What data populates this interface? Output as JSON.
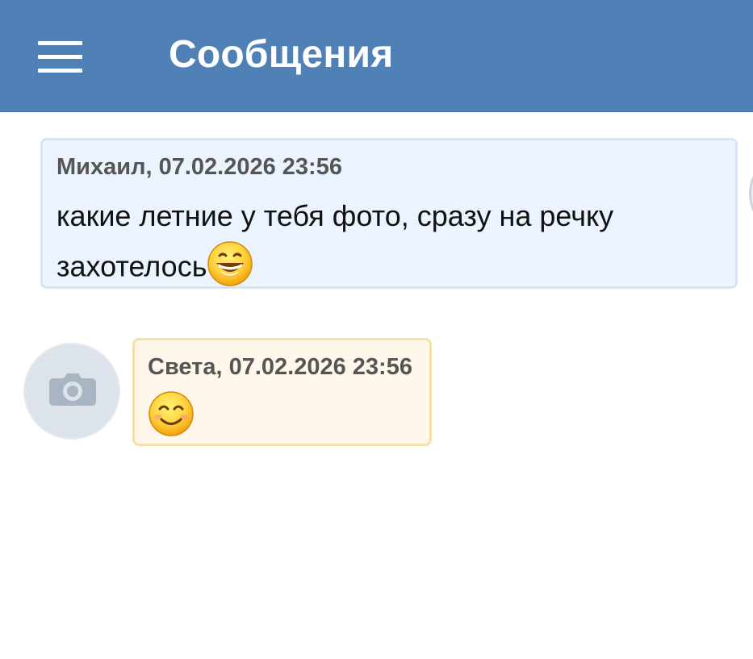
{
  "header": {
    "title": "Сообщения",
    "menu_icon": "hamburger-menu-icon",
    "background": "#4f80b6"
  },
  "messages": [
    {
      "author": "Михаил",
      "meta": "Михаил, 07.02.2026 23:56",
      "text_line1": "какие летние у тебя фото, сразу на речку",
      "text_line2": "захотелось",
      "emoji": "grinning-face-emoji",
      "bubble_color": "#ebf3fe"
    },
    {
      "author": "Света",
      "meta": "Света, 07.02.2026 23:56",
      "emoji": "smiling-face-emoji",
      "avatar_icon": "camera-icon",
      "bubble_color": "#fff7e9"
    }
  ]
}
